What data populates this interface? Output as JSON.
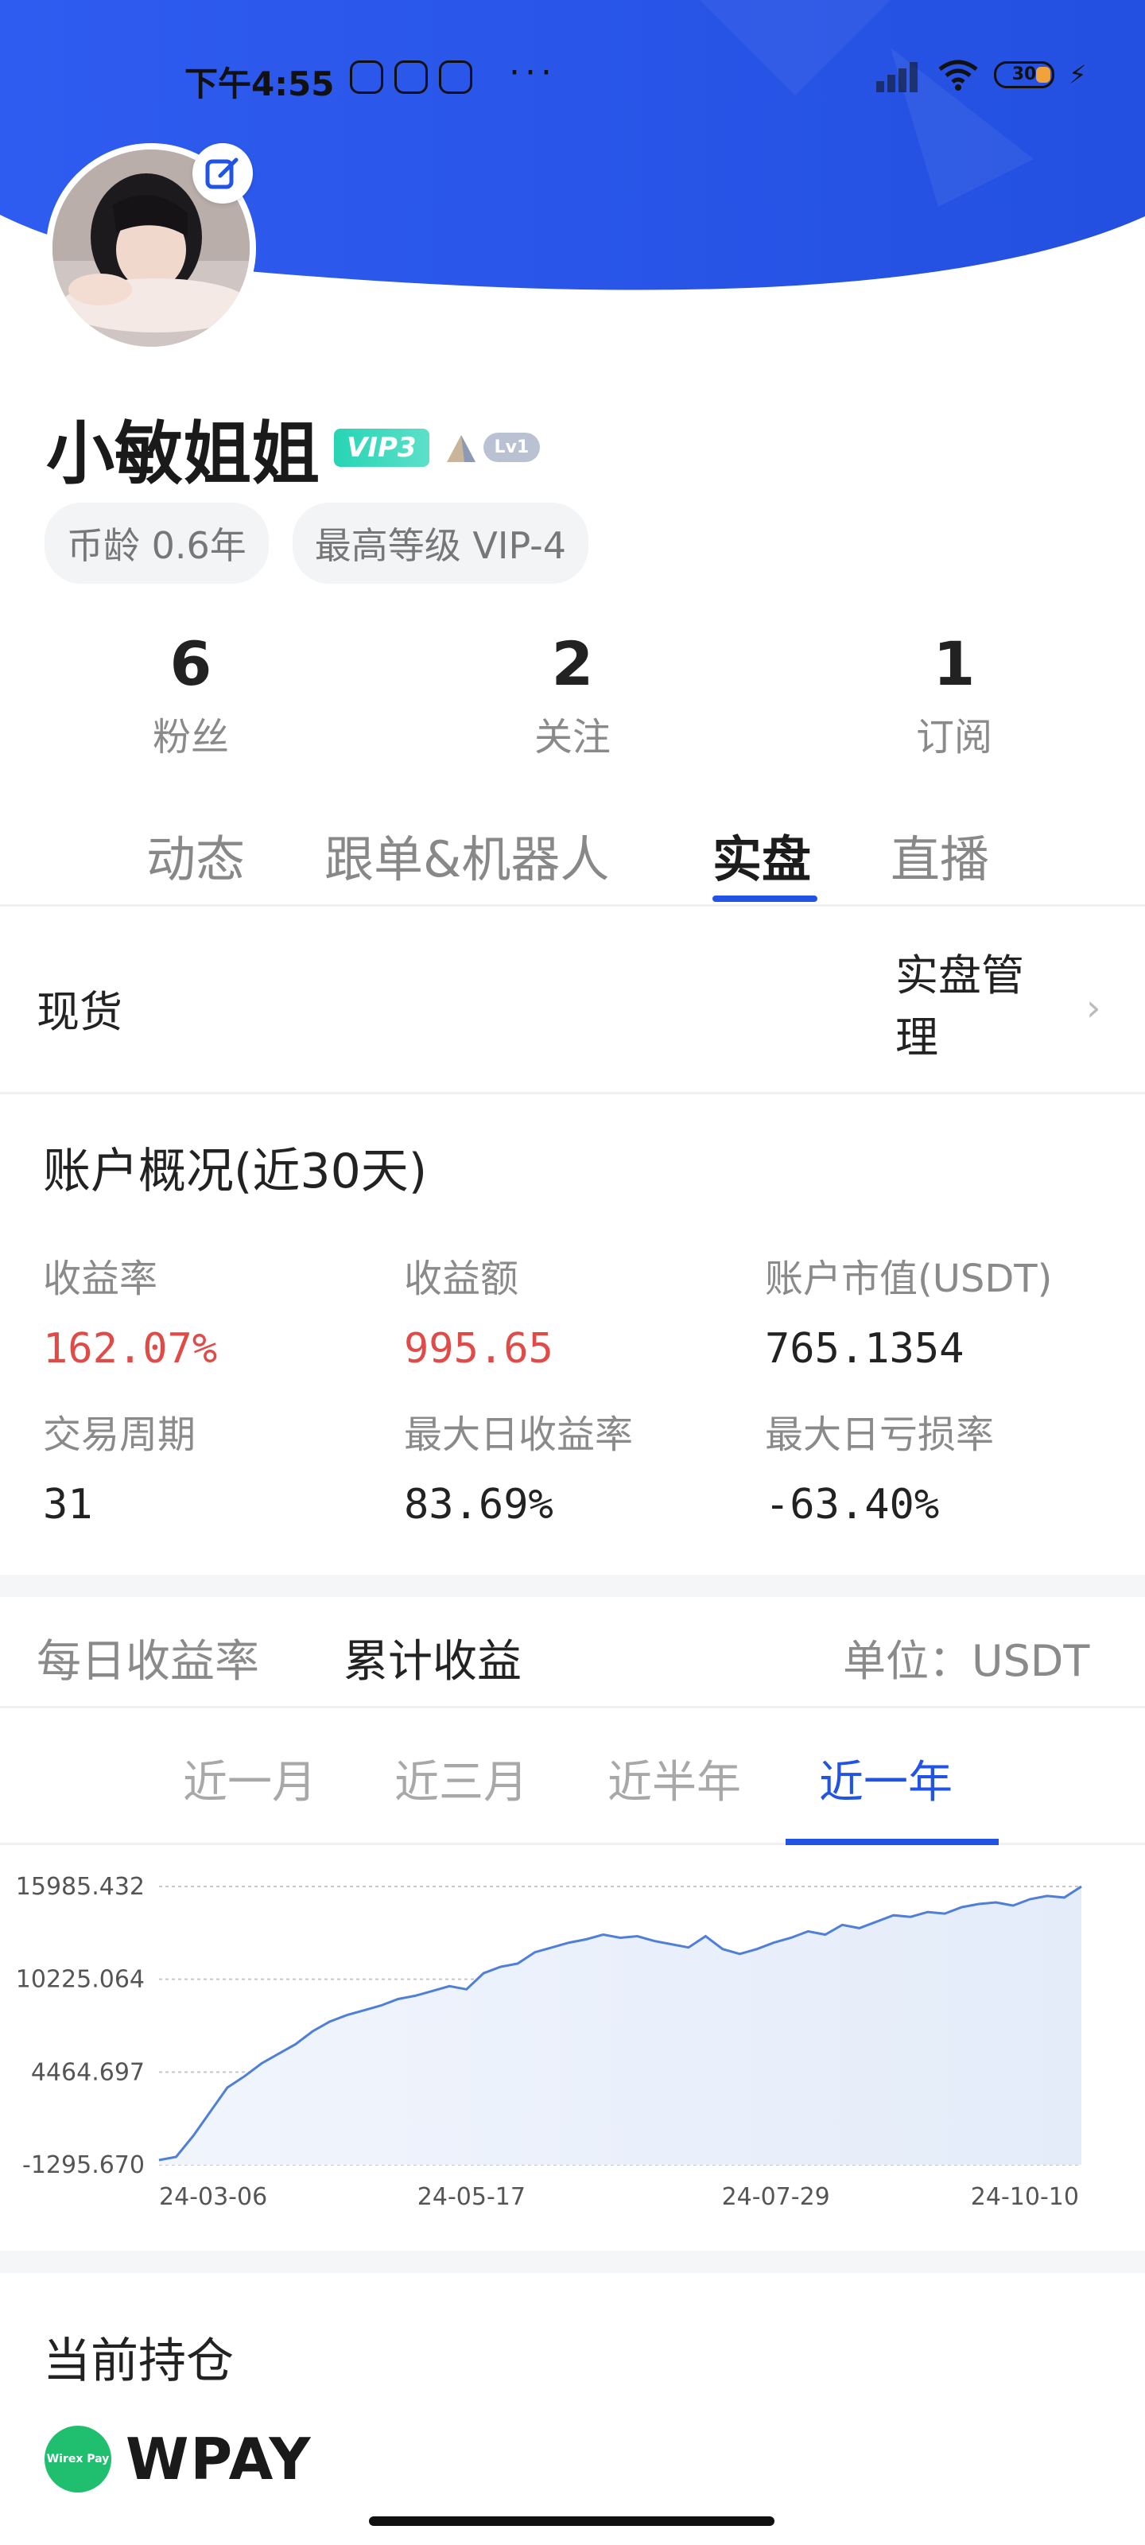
{
  "status_bar": {
    "time": "下午4:55",
    "more": "···",
    "battery": "30"
  },
  "profile": {
    "name": "小敏姐姐",
    "vip_badge": "VIP3",
    "level_badge": "Lv1",
    "chips": [
      "币龄 0.6年",
      "最高等级 VIP-4"
    ]
  },
  "stats": [
    {
      "value": "6",
      "label": "粉丝"
    },
    {
      "value": "2",
      "label": "关注"
    },
    {
      "value": "1",
      "label": "订阅"
    }
  ],
  "tabs": [
    "动态",
    "跟单&机器人",
    "实盘",
    "直播"
  ],
  "active_tab": "实盘",
  "spot": {
    "label": "现货",
    "manage_line1": "实盘管",
    "manage_line2": "理"
  },
  "overview": {
    "title": "账户概况(近30天)",
    "metrics": [
      {
        "label": "收益率",
        "value": "162.07%"
      },
      {
        "label": "收益额",
        "value": "995.65"
      },
      {
        "label": "账户市值(USDT)",
        "value": "765.1354"
      },
      {
        "label": "交易周期",
        "value": "31"
      },
      {
        "label": "最大日收益率",
        "value": "83.69%"
      },
      {
        "label": "最大日亏损率",
        "value": "-63.40%"
      }
    ]
  },
  "chart_tabs": {
    "daily": "每日收益率",
    "cumulative": "累计收益",
    "unit": "单位：USDT"
  },
  "range_tabs": [
    "近一月",
    "近三月",
    "近半年",
    "近一年"
  ],
  "holdings": {
    "title": "当前持仓",
    "item_name": "WPAY",
    "item_logo_text": "Wirex Pay"
  },
  "colors": {
    "primary": "#2153e4",
    "red": "#e04a47",
    "vip": "#27d4b4",
    "line": "#4f7fd9"
  },
  "chart_data": {
    "type": "area",
    "x_tick_labels": [
      "24-03-06",
      "24-05-17",
      "24-07-29",
      "24-10-10"
    ],
    "y_tick_labels": [
      "15985.432",
      "10225.064",
      "4464.697",
      "-1295.670"
    ],
    "ylim": [
      -1295.67,
      15985.432
    ],
    "grid": true,
    "series": [
      {
        "values": [
          -1000,
          -800,
          500,
          2000,
          3500,
          4200,
          5000,
          5600,
          6200,
          7000,
          7600,
          8000,
          8300,
          8600,
          9000,
          9200,
          9500,
          9800,
          9600,
          10600,
          11000,
          11200,
          11900,
          12200,
          12500,
          12700,
          13000,
          12800,
          12900,
          12600,
          12400,
          12200,
          12900,
          12100,
          11800,
          12100,
          12500,
          12800,
          13200,
          13000,
          13600,
          13400,
          13800,
          14200,
          14100,
          14400,
          14300,
          14700,
          14900,
          15000,
          14800,
          15200,
          15400,
          15300,
          15985
        ]
      }
    ]
  }
}
